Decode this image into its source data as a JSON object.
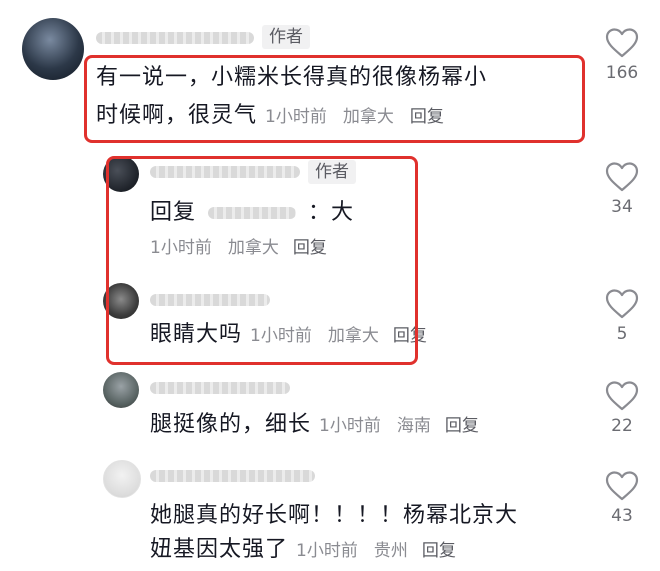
{
  "comments": [
    {
      "author_tag": "作者",
      "text_line1": "有一说一，小糯米长得真的很像杨幂小",
      "text_line2": "时候啊，很灵气",
      "time": "1小时前",
      "location": "加拿大",
      "reply_label": "回复",
      "likes": "166"
    },
    {
      "author_tag": "作者",
      "text_a": "回复",
      "text_b": "：大",
      "time": "1小时前",
      "location": "加拿大",
      "reply_label": "回复",
      "likes": "34"
    },
    {
      "text": "眼睛大吗",
      "time": "1小时前",
      "location": "加拿大",
      "reply_label": "回复",
      "likes": "5"
    },
    {
      "text": "腿挺像的，细长",
      "time": "1小时前",
      "location": "海南",
      "reply_label": "回复",
      "likes": "22"
    },
    {
      "text_line1": "她腿真的好长啊！！！！杨幂北京大",
      "text_line2": "妞基因太强了",
      "time": "1小时前",
      "location": "贵州",
      "reply_label": "回复",
      "likes": "43"
    }
  ],
  "icons": {
    "like": "heart-outline-icon"
  },
  "colors": {
    "highlight_box": "#e0312d",
    "meta": "#8a8b91"
  }
}
